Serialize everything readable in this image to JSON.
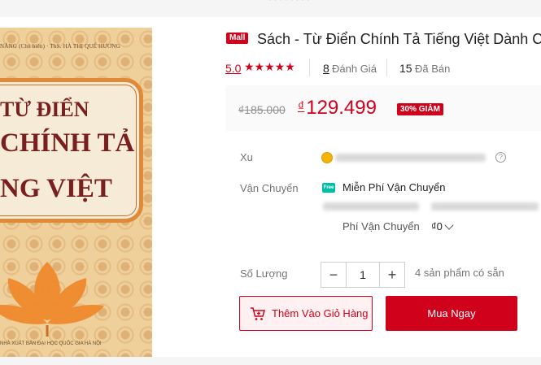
{
  "topbar": {
    "faint_text": "·  ·  ·  ·  ·  ·  ·  ·"
  },
  "book_cover": {
    "authors": "NĂNG (Chủ biên) · ThS. HÀ THỊ QUẾ HƯƠNG",
    "title_line1": "TỪ ĐIỂN",
    "title_line2": "CHÍNH TẢ",
    "title_line3": "NG VIỆT",
    "publisher": "NHÀ XUẤT BẢN ĐẠI HỌC QUỐC GIA HÀ NỘI"
  },
  "product": {
    "mall_badge": "Mall",
    "title": "Sách - Từ Điển Chính Tả Tiếng Việt Dành C",
    "rating": "5.0",
    "stars": "★★★★★",
    "review_count": "8",
    "review_label": "Đánh Giá",
    "sold_count": "15",
    "sold_label": "Đã Bán",
    "old_price": "₫185.000",
    "currency": "₫",
    "new_price": "129.499",
    "discount": "30% GIẢM"
  },
  "details": {
    "coin_label": "Xu",
    "shipping_label": "Vận Chuyển",
    "free_icon_text": "Free",
    "free_shipping": "Miễn Phí Vận Chuyển",
    "shipping_fee_label": "Phí Vận Chuyển",
    "shipping_fee_value": "₫0",
    "quantity_label": "Số Lượng",
    "quantity": "1",
    "minus": "−",
    "plus": "+",
    "stock": "4 sản phẩm có sẵn"
  },
  "actions": {
    "add_to_cart": "Thêm Vào Giỏ Hàng",
    "buy_now": "Mua Ngay"
  },
  "colors": {
    "accent": "#d0011b",
    "free_badge": "#00bfa5",
    "coin": "#f6b400"
  }
}
